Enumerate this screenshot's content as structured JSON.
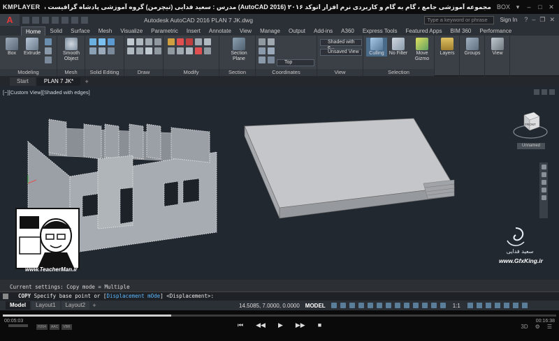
{
  "kmplayer": {
    "logo": "KMPLAYER",
    "video_title": "مجموعه آموزشی جامع ، گام به گام و کاربردی نرم افزار اتوکد ۲۰۱۶ (AutoCAD 2016)  مدرس : سعید فدایی (تیچرمن) گروه آموزشی پادشاه گرافیست ها",
    "top_right": "BOX",
    "time_current": "00:05:03",
    "time_total": "00:16:38",
    "progress": 0.304,
    "tags": [
      "H264",
      "AAC",
      "VBR"
    ]
  },
  "acad": {
    "logo": "A",
    "doc_title": "Autodesk AutoCAD 2016    PLAN 7 JK.dwg",
    "search_placeholder": "Type a keyword or phrase",
    "signin": "Sign In",
    "ribbon_tabs": [
      "Home",
      "Solid",
      "Surface",
      "Mesh",
      "Visualize",
      "Parametric",
      "Insert",
      "Annotate",
      "View",
      "Manage",
      "Output",
      "Add-ins",
      "A360",
      "Express Tools",
      "Featured Apps",
      "BIM 360",
      "Performance"
    ],
    "tools": {
      "box": "Box",
      "extrude": "Extrude",
      "smooth_object": "Smooth Object",
      "section_plane": "Section Plane",
      "culling": "Culling",
      "no_filter": "No Filter",
      "move_gizmo": "Move Gizmo",
      "layers": "Layers",
      "groups": "Groups",
      "view": "View"
    },
    "dropdowns": {
      "visual_style": "Shaded with e...",
      "saved_view": "Unsaved View",
      "view_dir": "Top",
      "world": "World"
    },
    "panels": [
      "Modeling",
      "Mesh",
      "Solid Editing",
      "Draw",
      "Modify",
      "Section",
      "Coordinates",
      "View",
      "Selection"
    ],
    "file_tabs": [
      "Start",
      "PLAN 7 JK*"
    ],
    "view_label": "[−][Custom View][Shaded with edges]",
    "unnamed": "Unnamed",
    "viewcube_face": "FRONT",
    "cmd_history": "Current settings:  Copy mode = Multiple",
    "cmd_prefix": "COPY",
    "cmd_text": "Specify base point or",
    "cmd_option": "Displacement",
    "cmd_mode": "mOde",
    "cmd_end": "<Displacement>:",
    "layout_tabs": [
      "Model",
      "Layout1",
      "Layout2"
    ],
    "coords": "14.5085, 7.0000, 0.0000",
    "model_btn": "MODEL",
    "scale": "1:1"
  },
  "watermarks": {
    "teacher_name": "Teacher Man",
    "teacher_fa": "تیچرمن",
    "teacher_url": "www.TeacherMan.ir",
    "gfx_name": "سعید فدایی",
    "gfx_url": "www.GfxKing.ir"
  },
  "colors": {
    "viewport_bg": "#212830",
    "ribbon_bg": "#3b4047",
    "accent_red": "#e23a3a",
    "cmd_keyword": "#5cb8ff"
  }
}
